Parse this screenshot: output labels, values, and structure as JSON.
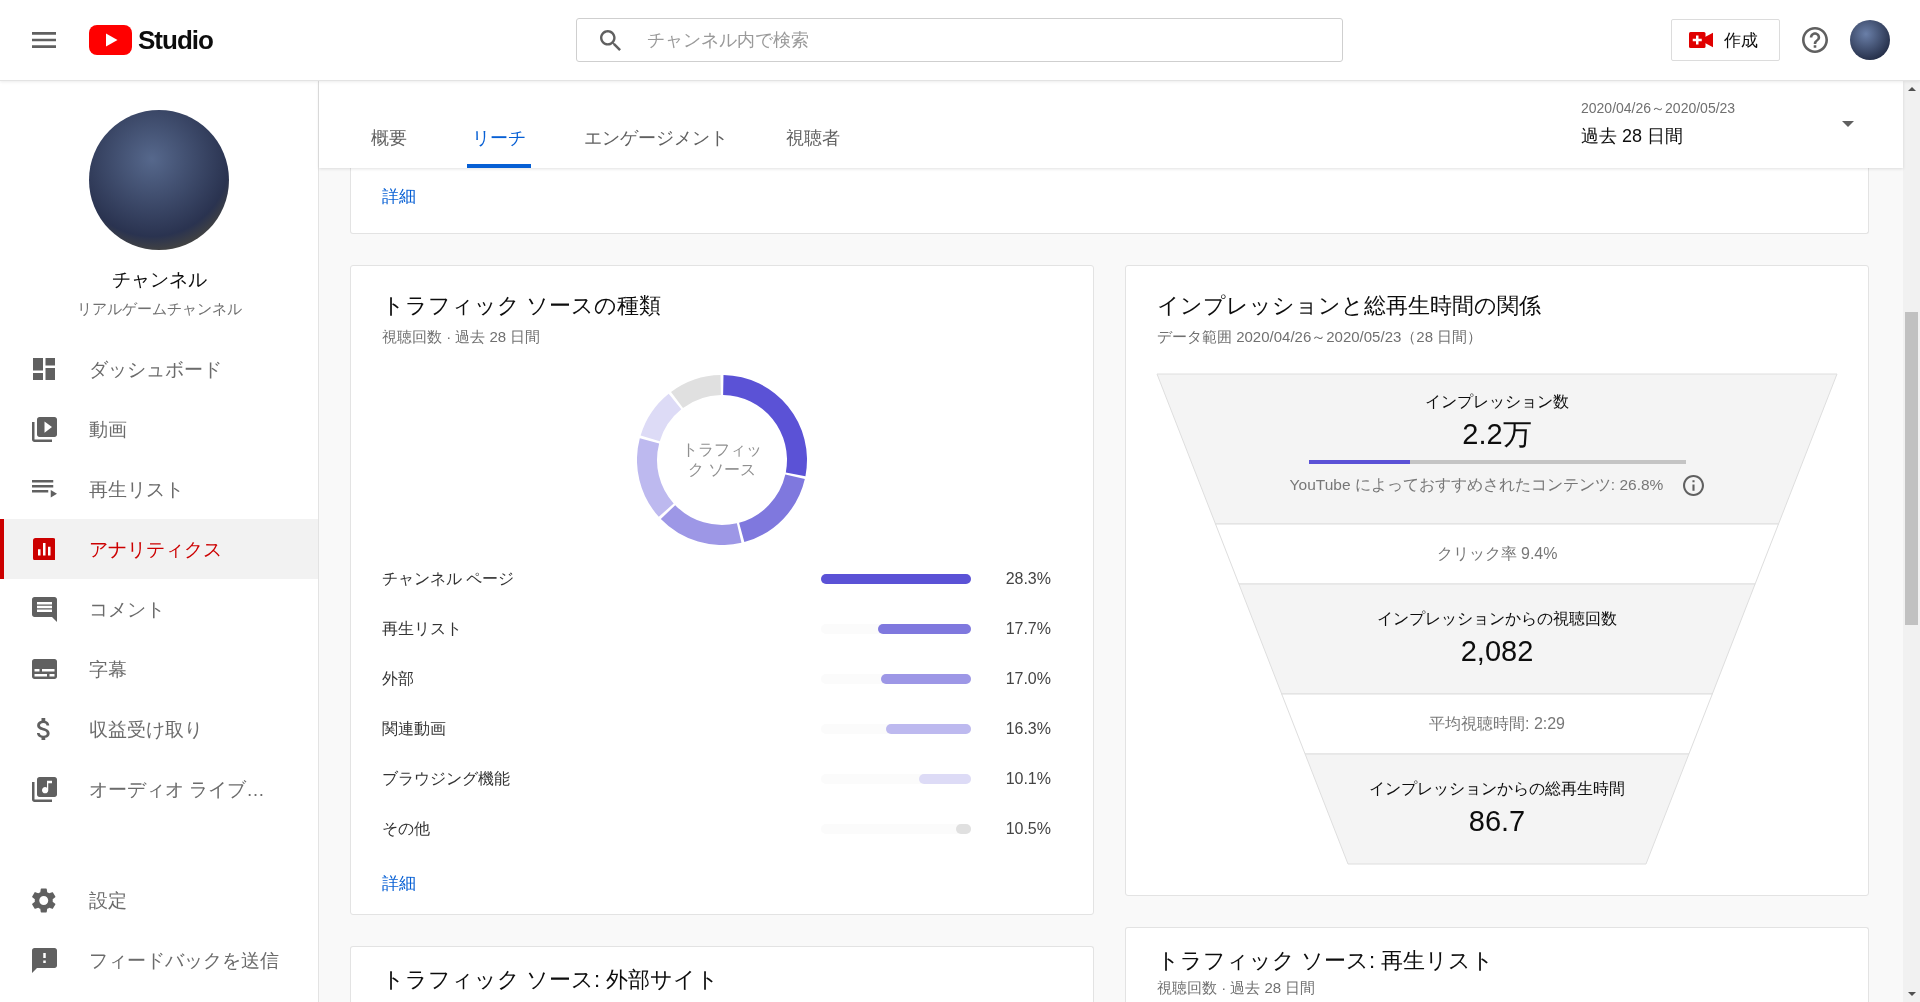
{
  "header": {
    "logo_text": "Studio",
    "search": {
      "placeholder": "チャンネル内で検索"
    },
    "create_label": "作成"
  },
  "sidebar": {
    "channel_title": "チャンネル",
    "channel_name": "リアルゲームチャンネル",
    "items": [
      {
        "kind": "dashboard",
        "label": "ダッシュボード",
        "selected": false
      },
      {
        "kind": "videos",
        "label": "動画",
        "selected": false
      },
      {
        "kind": "playlists",
        "label": "再生リスト",
        "selected": false
      },
      {
        "kind": "analytics",
        "label": "アナリティクス",
        "selected": true
      },
      {
        "kind": "comments",
        "label": "コメント",
        "selected": false
      },
      {
        "kind": "subtitles",
        "label": "字幕",
        "selected": false
      },
      {
        "kind": "monetization",
        "label": "収益受け取り",
        "selected": false
      },
      {
        "kind": "audio_library",
        "label": "オーディオ ライブ…",
        "selected": false
      }
    ],
    "footer_items": [
      {
        "kind": "settings",
        "label": "設定",
        "selected": false
      },
      {
        "kind": "feedback",
        "label": "フィードバックを送信",
        "selected": false
      }
    ]
  },
  "tabs": [
    {
      "label": "概要",
      "selected": false
    },
    {
      "label": "リーチ",
      "selected": true
    },
    {
      "label": "エンゲージメント",
      "selected": false
    },
    {
      "label": "視聴者",
      "selected": false
    }
  ],
  "date_range": {
    "dates": "2020/04/26～2020/05/23",
    "period": "過去 28 日間"
  },
  "details_card": {
    "link": "詳細"
  },
  "traffic_sources": {
    "title": "トラフィック ソースの種類",
    "subtitle": "視聴回数 · 過去 28 日間",
    "chart_data": {
      "type": "donut",
      "title": "トラフィック ソース",
      "categories": [
        "チャンネル ページ",
        "再生リスト",
        "外部",
        "関連動画",
        "ブラウジング機能",
        "その他"
      ],
      "values": [
        28.3,
        17.7,
        17.0,
        16.3,
        10.1,
        10.5
      ],
      "value_labels": [
        "28.3%",
        "17.7%",
        "17.0%",
        "16.3%",
        "10.1%",
        "10.5%"
      ]
    },
    "legend_bars": [
      {
        "color": "#5b52d6",
        "level": 1
      },
      {
        "color": "#7f78de",
        "level": 0.62
      },
      {
        "color": "#9d97e6",
        "level": 0.6
      },
      {
        "color": "#bdb9ef",
        "level": 0.57
      },
      {
        "color": "#dddbf6",
        "level": 0.35
      },
      {
        "color": "#e0e0e0",
        "level": 0.1
      }
    ],
    "link": "詳細"
  },
  "funnel": {
    "title": "インプレッションと総再生時間の関係",
    "subtitle": "データ範囲 2020/04/26～2020/05/23（28 日間）",
    "stages": [
      {
        "kind": "metric",
        "label": "インプレッション数",
        "value": "2.2万",
        "share": {
          "level": 0.268,
          "text": "YouTube によっておすすめされたコンテンツ: 26.8%"
        }
      },
      {
        "kind": "rate",
        "text": "クリック率 9.4%"
      },
      {
        "kind": "metric",
        "label": "インプレッションからの視聴回数",
        "value": "2,082"
      },
      {
        "kind": "rate",
        "text": "平均視聴時間: 2:29"
      },
      {
        "kind": "metric",
        "label": "インプレッションからの総再生時間",
        "value": "86.7"
      }
    ]
  },
  "more_cards": [
    {
      "title": "トラフィック ソース: 外部サイト"
    },
    {
      "title": "トラフィック ソース: 再生リスト",
      "subtitle": "視聴回数 · 過去 28 日間"
    }
  ]
}
